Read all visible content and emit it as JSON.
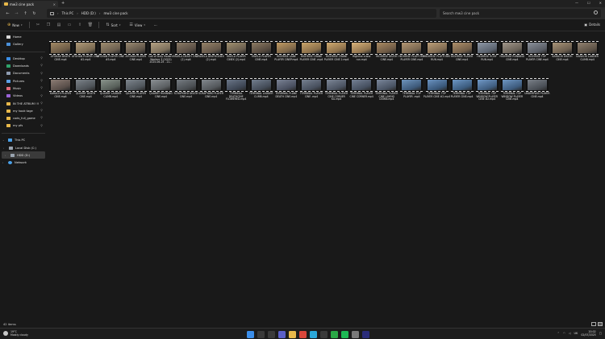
{
  "window": {
    "tab_title": "mw3 cine pack",
    "tab_close": "×",
    "new_tab": "+",
    "controls": [
      "—",
      "☐",
      "✕"
    ]
  },
  "nav": {
    "back": "←",
    "forward": "→",
    "up": "↑",
    "refresh": "↻",
    "breadcrumb": [
      "This PC",
      "HDD (D:)",
      "mw3 cine pack"
    ],
    "separator": "›",
    "search_placeholder": "Search mw3 cine pack"
  },
  "toolbar": {
    "new_label": "New",
    "sort_label": "Sort",
    "view_label": "View",
    "more": "···",
    "details_label": "Details"
  },
  "sidebar": {
    "top": [
      {
        "label": "Home",
        "color": "#d9d9d9"
      },
      {
        "label": "Gallery",
        "color": "#4a90d9"
      }
    ],
    "quick": [
      {
        "label": "Desktop",
        "color": "#3a8ee6"
      },
      {
        "label": "Downloads",
        "color": "#2fa36b"
      },
      {
        "label": "Documents",
        "color": "#8e9bb0"
      },
      {
        "label": "Pictures",
        "color": "#5aa0e6"
      },
      {
        "label": "Music",
        "color": "#e06a7a"
      },
      {
        "label": "Videos",
        "color": "#9a63d6"
      },
      {
        "label": "IN THE ATRIUM !!!",
        "color": "#e8b84a"
      },
      {
        "label": "my hook tage",
        "color": "#e8b84a"
      },
      {
        "label": "cods_full_game",
        "color": "#e8b84a"
      },
      {
        "label": "my pfs",
        "color": "#e8b84a"
      }
    ],
    "this_pc": "This PC",
    "drives": [
      {
        "label": "Local Disk (C:)",
        "active": false
      },
      {
        "label": "HDD (D:)",
        "active": true
      }
    ],
    "network": "Network"
  },
  "files_row1": [
    {
      "name": "AFGHAN DEATH CINE.mp4",
      "c1": "#6b5a45",
      "c2": "#a38a66"
    },
    {
      "name": "AFGHAN PLAYER CINE #2.mp4",
      "c1": "#7a6a52",
      "c2": "#b09a78"
    },
    {
      "name": "AFGHAN PLAYER CINE #3.mp4",
      "c1": "#6d6050",
      "c2": "#9f8d70"
    },
    {
      "name": "AFGHAN PLAYER CINE.mp4",
      "c1": "#5f5448",
      "c2": "#9a8a72"
    },
    {
      "name": "Call of Duty Modern Warfare 3 (2023) 2025-06-25 - 21...",
      "c1": "#7d705c",
      "c2": "#b5a284"
    },
    {
      "name": "FAVELA DEATH CINE (2).mp4",
      "c1": "#5a4e44",
      "c2": "#8a7a66"
    },
    {
      "name": "FAVELA DEATHCINEX (2).mp4",
      "c1": "#66584a",
      "c2": "#958268"
    },
    {
      "name": "FAVELA PLAYER CINEX (2).mp4",
      "c1": "#6a5e4f",
      "c2": "#a0906f"
    },
    {
      "name": "FAVELA PLAYER CINE.mp4",
      "c1": "#564a3f",
      "c2": "#8d7b63"
    },
    {
      "name": "HIGHRISE LANE PLAYER CINEP.mp4",
      "c1": "#7b6548",
      "c2": "#c09a62"
    },
    {
      "name": "HIGHRISE CRANE PLAYER CINE .mp4",
      "c1": "#8a6f4a",
      "c2": "#c9a46a"
    },
    {
      "name": "HIGHRISE CRANE PLAYER CINE 2.mp4",
      "c1": "#8c704b",
      "c2": "#d0aa70"
    },
    {
      "name": "Highrise crane run.mp4",
      "c1": "#937650",
      "c2": "#d8b27a"
    },
    {
      "name": "HIGHRISE DEATH CINE.mp4",
      "c1": "#6e5a45",
      "c2": "#a98a62"
    },
    {
      "name": "HIGHRISE PLATFORM PLAYER CINE.mp4",
      "c1": "#7a6750",
      "c2": "#b39774"
    },
    {
      "name": "HIGHRISE PLATFORM RUN.mp4",
      "c1": "#806b52",
      "c2": "#bb9e78"
    },
    {
      "name": "HIGHRISE PLAYER CINE.mp4",
      "c1": "#735f49",
      "c2": "#ad8f6a"
    },
    {
      "name": "HIGHRISE ROOF RUN.mp4",
      "c1": "#5c6470",
      "c2": "#8e98a6"
    },
    {
      "name": "HIGHRISE RUNNING CINE.mp4",
      "c1": "#6a6258",
      "c2": "#a0968a"
    },
    {
      "name": "HIGHRISE TOP PLAYER CINE.mp4",
      "c1": "#5a5e66",
      "c2": "#8a909a"
    },
    {
      "name": "KARACHI DEATH CINE.mp4",
      "c1": "#6e6050",
      "c2": "#a89478"
    },
    {
      "name": "KARACHI LADDER CLIMB.mp4",
      "c1": "#5d5246",
      "c2": "#918170"
    }
  ],
  "files_row2": [
    {
      "name": "KARACHI PLAYER CINE.mp4",
      "c1": "#5a4f4a",
      "c2": "#8c7c74"
    },
    {
      "name": "QUARRY DEATH CINE.mp4",
      "c1": "#4e5358",
      "c2": "#7c838a"
    },
    {
      "name": "QUARRY LADDER CLIMB.mp4",
      "c1": "#58605a",
      "c2": "#8a948c"
    },
    {
      "name": "QUARRY PLAYER CINE.mp4",
      "c1": "#50565c",
      "c2": "#7e868e"
    },
    {
      "name": "QUARRY RUNNING CINE.mp4",
      "c1": "#5b5f62",
      "c2": "#8b9094"
    },
    {
      "name": "SCRAPYARD DEATH CINE.mp4",
      "c1": "#4a4e52",
      "c2": "#767c82"
    },
    {
      "name": "SCRAPYARD PLAYER CINE.mp4",
      "c1": "#54585c",
      "c2": "#82888e"
    },
    {
      "name": "TERMINAL DEATHCINE FLOWERED.mp4",
      "c1": "#3e4654",
      "c2": "#6a7688"
    },
    {
      "name": "TERMINAL LADDER CLIMB.mp4",
      "c1": "#444c58",
      "c2": "#727e8e"
    },
    {
      "name": "TERMINAL PLANE DEATH CINE.mp4",
      "c1": "#4a5060",
      "c2": "#7a8294"
    },
    {
      "name": "TERMINAL PLAYER CINE .mp4",
      "c1": "#48505e",
      "c2": "#768090"
    },
    {
      "name": "TERMINAL PLAYER CINE CORNER KG.mp4",
      "c1": "#4c5462",
      "c2": "#7c8696"
    },
    {
      "name": "TERMINAL PLAYER CINE CORNER.mp4",
      "c1": "#465060",
      "c2": "#748094"
    },
    {
      "name": "TERMINAL PLAYER CINE LAYING DOWN.mp4",
      "c1": "#4a5464",
      "c2": "#7a869a"
    },
    {
      "name": "TERMINAL TOP PLAYER .mp4",
      "c1": "#3e5a7a",
      "c2": "#6e94bc"
    },
    {
      "name": "TERMINAL TOP PLAYER CINE #2.mp4",
      "c1": "#3a587a",
      "c2": "#6a92c0"
    },
    {
      "name": "TERMINAL TOP PLAYER CINE.mp4",
      "c1": "#3c5c7e",
      "c2": "#6c96c4"
    },
    {
      "name": "TERMINAL TOP WINDOW PLAYER CINE #2.mp4",
      "c1": "#405e80",
      "c2": "#7098c6"
    },
    {
      "name": "TERMINAL TOP WINDOW PLAYER CINE.mp4",
      "c1": "#3e5c7e",
      "c2": "#6e96c2"
    },
    {
      "name": "UNDERPASS PLAYER CINE.mp4",
      "c1": "#4a4f56",
      "c2": "#7a8088"
    }
  ],
  "status": {
    "item_count": "42 items"
  },
  "taskbar": {
    "weather_temp": "19°C",
    "weather_desc": "Mostly cloudy",
    "time": "20:02",
    "date": "02/07/2025",
    "tray_lang": "UK",
    "apps": [
      {
        "name": "start",
        "color": "#3b8eea"
      },
      {
        "name": "search",
        "color": "#3a3a3a"
      },
      {
        "name": "taskview",
        "color": "#3a3a3a"
      },
      {
        "name": "chat",
        "color": "#5b5fc7"
      },
      {
        "name": "explorer",
        "color": "#e8b84a"
      },
      {
        "name": "chrome",
        "color": "#d9463a"
      },
      {
        "name": "edge",
        "color": "#2aa7d8"
      },
      {
        "name": "store",
        "color": "#3a3a3a"
      },
      {
        "name": "xbox",
        "color": "#2aa846"
      },
      {
        "name": "spotify",
        "color": "#1db954"
      },
      {
        "name": "settings",
        "color": "#7a7a7a"
      },
      {
        "name": "premiere",
        "color": "#2b2d7a"
      }
    ]
  }
}
